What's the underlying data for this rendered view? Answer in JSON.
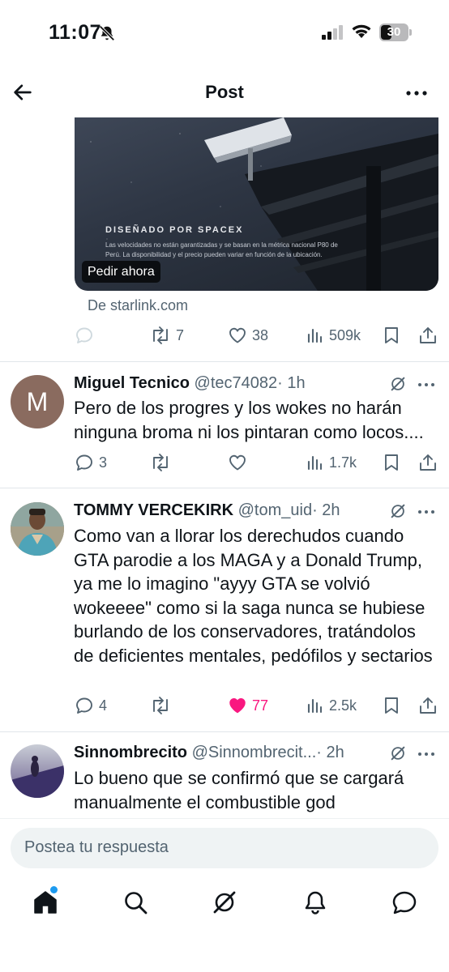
{
  "status_bar": {
    "time": "11:07",
    "battery": "30"
  },
  "header": {
    "title": "Post"
  },
  "ad": {
    "brand": "DISEÑADO POR SPACEX",
    "disclaimer": "Las velocidades no están garantizadas y se basan en la métrica nacional P80 de Perú. La disponibilidad y el precio pueden variar en función de la ubicación.",
    "cta": "Pedir ahora",
    "source": "De starlink.com",
    "actions": {
      "reposts": "7",
      "likes": "38",
      "views": "509k"
    }
  },
  "replies": [
    {
      "name": "Miguel Tecnico",
      "handle": "@tec74082",
      "time": "· 1h",
      "avatar_letter": "M",
      "text": "Pero de los progres y los wokes no harán ninguna broma ni los pintaran como locos....",
      "actions": {
        "replies": "3",
        "reposts": "",
        "likes": "",
        "views": "1.7k"
      }
    },
    {
      "name": "TOMMY VERCEKIRK",
      "handle": "@tom_uid",
      "time": "· 2h",
      "text": "Como van a llorar los derechudos cuando GTA parodie a los MAGA y a Donald Trump, ya me lo imagino \"ayyy GTA se volvió wokeeee\" como si la saga nunca se hubiese burlando de los conservadores, tratándolos de deficientes mentales, pedófilos y sectarios",
      "actions": {
        "replies": "4",
        "reposts": "",
        "likes": "77",
        "views": "2.5k"
      }
    },
    {
      "name": "Sinnombrecito",
      "handle": "@Sinnombrecit...",
      "time": "· 2h",
      "text": "Lo bueno que se confirmó que se cargará manualmente el combustible god"
    }
  ],
  "reply_bar": {
    "placeholder": "Postea tu respuesta"
  },
  "colors": {
    "like_active": "#f91880",
    "secondary_text": "#536471",
    "accent": "#1d9bf0"
  }
}
